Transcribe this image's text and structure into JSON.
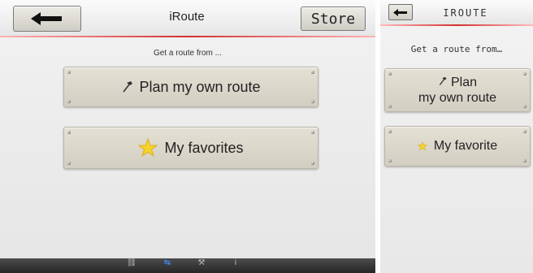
{
  "left": {
    "header": {
      "title": "iRoute",
      "store_label": "Store",
      "back_icon": "arrow-left-icon"
    },
    "subtitle": "Get a route from ...",
    "buttons": [
      {
        "label": "Plan my own route",
        "icon": "hammer-icon"
      },
      {
        "label": "My favorites",
        "icon": "star-icon"
      }
    ],
    "tabbar": {
      "active_index": 1,
      "items": [
        {
          "icon": "walker-icon",
          "label": ""
        },
        {
          "icon": "route-icon",
          "label": ""
        },
        {
          "icon": "wrench-icon",
          "label": ""
        },
        {
          "icon": "info-icon",
          "label": ""
        }
      ]
    }
  },
  "right": {
    "header": {
      "title": "IROUTE",
      "back_icon": "arrow-left-icon"
    },
    "subtitle": "Get a route from…",
    "buttons": [
      {
        "label_line1": "Plan",
        "label_line2": "my own route",
        "icon": "hammer-icon"
      },
      {
        "label": "My favorite",
        "icon": "star-icon"
      }
    ]
  },
  "colors": {
    "accent_red": "#d43030",
    "tab_active": "#3d8cf0",
    "plate": "#dcd8cc"
  }
}
